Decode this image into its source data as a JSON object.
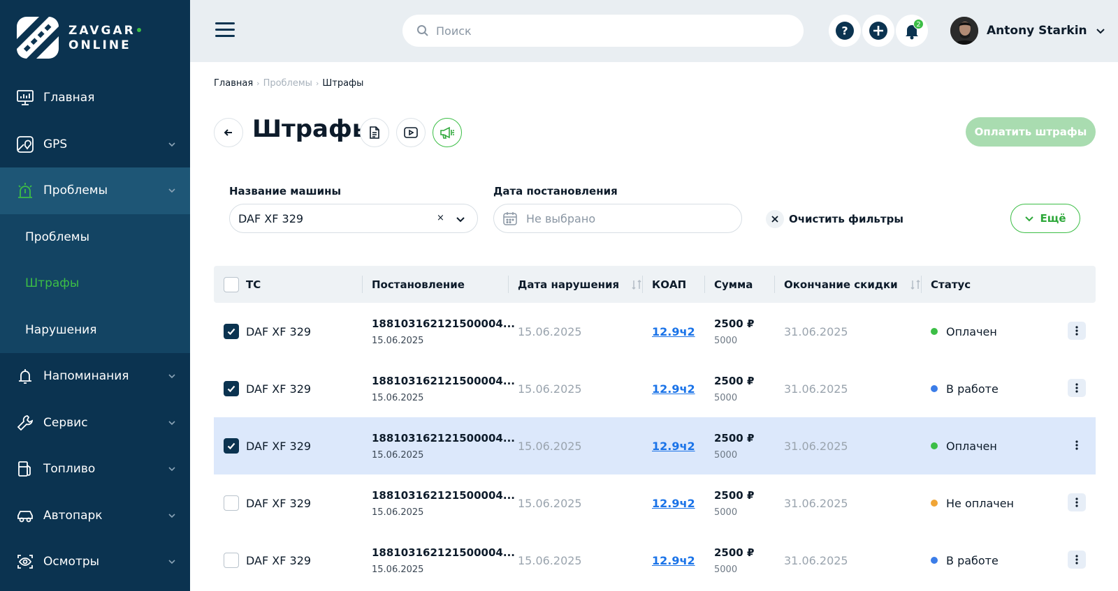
{
  "logo": {
    "line1": "ZAVGAR",
    "line2": "ONLINE"
  },
  "sidebar": {
    "items": [
      {
        "label": "Главная",
        "icon": "dashboard-icon",
        "chevron": false
      },
      {
        "label": "GPS",
        "icon": "map-icon",
        "chevron": true
      },
      {
        "label": "Проблемы",
        "icon": "alarm-icon",
        "chevron": true,
        "active": true
      },
      {
        "label": "Напоминания",
        "icon": "bell-icon",
        "chevron": true
      },
      {
        "label": "Сервис",
        "icon": "wrench-icon",
        "chevron": true
      },
      {
        "label": "Топливо",
        "icon": "fuel-icon",
        "chevron": true
      },
      {
        "label": "Автопарк",
        "icon": "car-icon",
        "chevron": true
      },
      {
        "label": "Осмотры",
        "icon": "eye-icon",
        "chevron": true
      }
    ],
    "sub_items": [
      {
        "label": "Проблемы"
      },
      {
        "label": "Штрафы",
        "active": true
      },
      {
        "label": "Нарушения"
      }
    ]
  },
  "header": {
    "search_placeholder": "Поиск",
    "notifications_count": "2",
    "user_name": "Antony Starkin"
  },
  "breadcrumb": {
    "home": "Главная",
    "section": "Проблемы",
    "current": "Штрафы"
  },
  "page": {
    "title": "Штрафы",
    "pay_button": "Оплатить штрафы"
  },
  "filters": {
    "car_label": "Название машины",
    "car_value": "DAF XF 329",
    "date_label": "Дата постановления",
    "date_placeholder": "Не выбрано",
    "clear_label": "Очистить фильтры",
    "more_label": "Ещё"
  },
  "table": {
    "columns": [
      "ТС",
      "Постановление",
      "Дата нарушения",
      "КОАП",
      "Сумма",
      "Окончание скидки",
      "Статус"
    ],
    "rows": [
      {
        "vehicle": "DAF XF 329",
        "decree": "188103162121500004...",
        "decree_date": "15.06.2025",
        "violation_date": "15.06.2025",
        "koap": "12.9ч2",
        "sum": "2500 ₽",
        "sum_full": "5000",
        "discount_end": "31.06.2025",
        "status": "Оплачен",
        "status_color": "#3cbe46",
        "checked": true,
        "highlight": false
      },
      {
        "vehicle": "DAF XF 329",
        "decree": "188103162121500004...",
        "decree_date": "15.06.2025",
        "violation_date": "15.06.2025",
        "koap": "12.9ч2",
        "sum": "2500 ₽",
        "sum_full": "5000",
        "discount_end": "31.06.2025",
        "status": "В работе",
        "status_color": "#3b7de8",
        "checked": true,
        "highlight": false
      },
      {
        "vehicle": "DAF XF 329",
        "decree": "188103162121500004...",
        "decree_date": "15.06.2025",
        "violation_date": "15.06.2025",
        "koap": "12.9ч2",
        "sum": "2500 ₽",
        "sum_full": "5000",
        "discount_end": "31.06.2025",
        "status": "Оплачен",
        "status_color": "#3cbe46",
        "checked": true,
        "highlight": true
      },
      {
        "vehicle": "DAF XF 329",
        "decree": "188103162121500004...",
        "decree_date": "15.06.2025",
        "violation_date": "15.06.2025",
        "koap": "12.9ч2",
        "sum": "2500 ₽",
        "sum_full": "5000",
        "discount_end": "31.06.2025",
        "status": "Не оплачен",
        "status_color": "#f0a536",
        "checked": false,
        "highlight": false
      },
      {
        "vehicle": "DAF XF 329",
        "decree": "188103162121500004...",
        "decree_date": "15.06.2025",
        "violation_date": "15.06.2025",
        "koap": "12.9ч2",
        "sum": "2500 ₽",
        "sum_full": "5000",
        "discount_end": "31.06.2025",
        "status": "В работе",
        "status_color": "#3b7de8",
        "checked": false,
        "highlight": false
      }
    ]
  },
  "colors": {
    "sidebar": "#0b3350",
    "accent": "#3cbe46",
    "link": "#1a73e8",
    "row_highlight": "#dce8fb"
  }
}
